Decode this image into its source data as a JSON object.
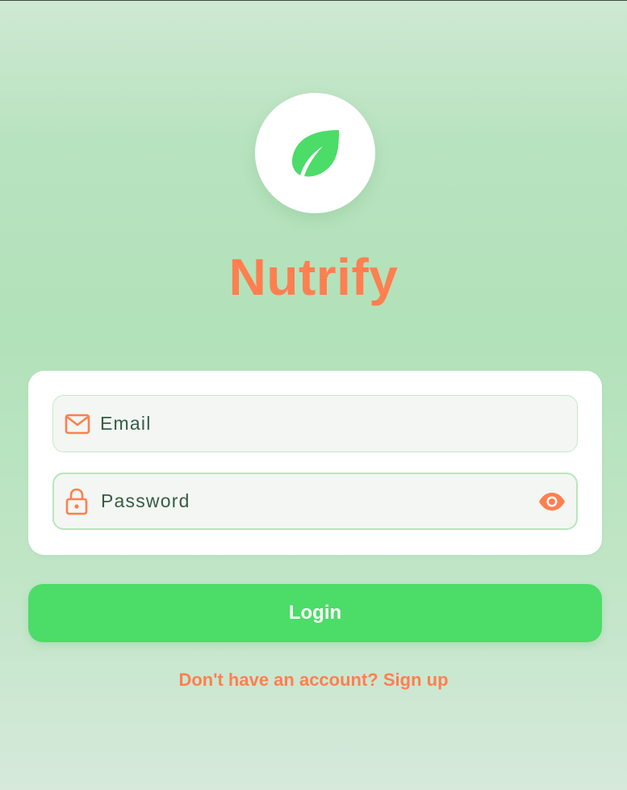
{
  "app": {
    "title": "Nutrify",
    "logo_icon": "leaf-icon"
  },
  "form": {
    "email": {
      "placeholder": "Email",
      "value": "",
      "icon": "mail-icon"
    },
    "password": {
      "placeholder": "Password",
      "value": "",
      "icon": "lock-icon",
      "toggle_icon": "eye-icon"
    }
  },
  "actions": {
    "login_label": "Login",
    "signup_prompt": "Don't have an account? Sign up"
  },
  "colors": {
    "accent": "#ff7f50",
    "primary_button": "#4cdc68",
    "leaf": "#4cdc68",
    "background": "#b8e3bf"
  }
}
